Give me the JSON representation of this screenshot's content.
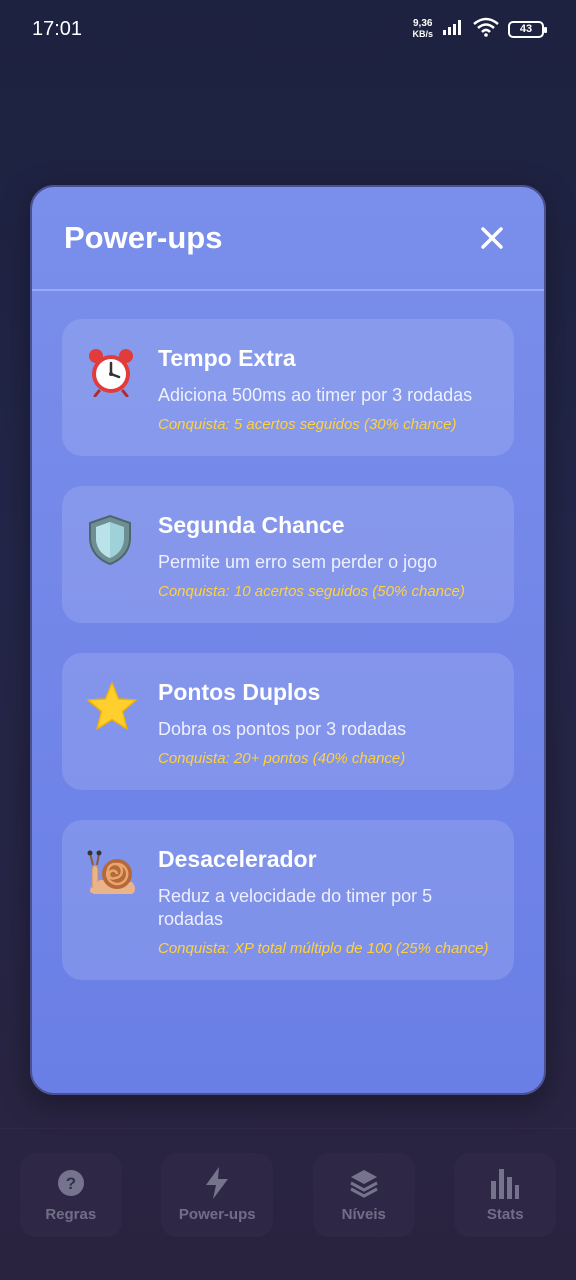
{
  "status": {
    "time": "17:01",
    "net_speed_value": "9,36",
    "net_speed_unit": "KB/s",
    "battery": "43"
  },
  "modal": {
    "title": "Power-ups",
    "cards": [
      {
        "icon": "alarm-clock-icon",
        "title": "Tempo Extra",
        "desc": "Adiciona 500ms ao timer por 3 rodadas",
        "unlock": "Conquista: 5 acertos seguidos (30% chance)"
      },
      {
        "icon": "shield-icon",
        "title": "Segunda Chance",
        "desc": "Permite um erro sem perder o jogo",
        "unlock": "Conquista: 10 acertos seguidos (50% chance)"
      },
      {
        "icon": "star-icon",
        "title": "Pontos Duplos",
        "desc": "Dobra os pontos por 3 rodadas",
        "unlock": "Conquista: 20+ pontos (40% chance)"
      },
      {
        "icon": "snail-icon",
        "title": "Desacelerador",
        "desc": "Reduz a velocidade do timer por 5 rodadas",
        "unlock": "Conquista: XP total múltiplo de 100 (25% chance)"
      }
    ]
  },
  "nav": [
    {
      "label": "Regras",
      "icon": "question-circle-icon"
    },
    {
      "label": "Power-ups",
      "icon": "lightning-icon"
    },
    {
      "label": "Níveis",
      "icon": "layers-icon"
    },
    {
      "label": "Stats",
      "icon": "bar-chart-icon"
    }
  ]
}
